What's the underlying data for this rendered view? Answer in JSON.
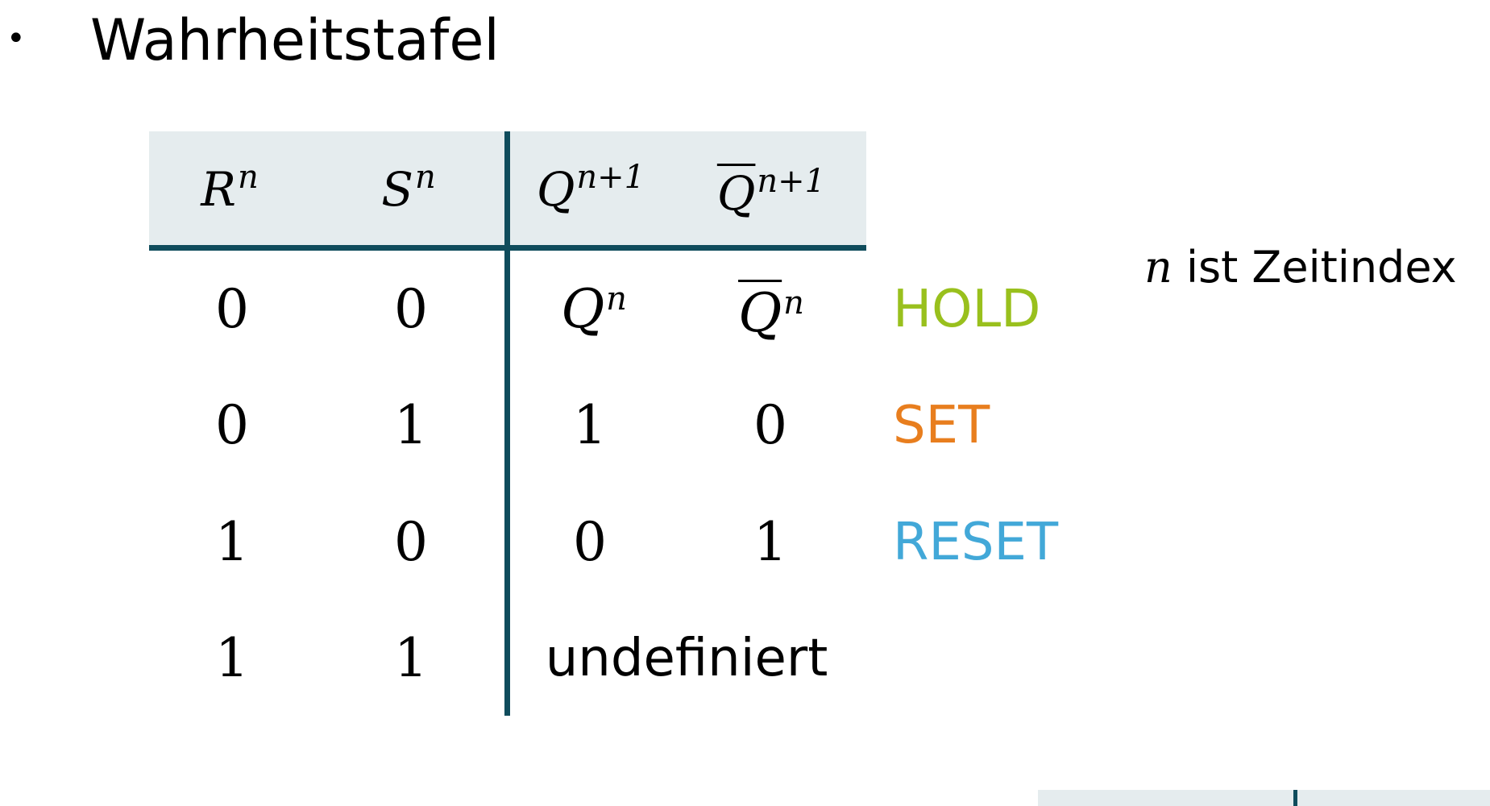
{
  "heading": {
    "bullet": "•",
    "title": "Wahrheitstafel"
  },
  "table": {
    "headers": {
      "r": {
        "base": "R",
        "sup": "n"
      },
      "s": {
        "base": "S",
        "sup": "n"
      },
      "q_next": {
        "base": "Q",
        "sup": "n+1"
      },
      "qbar_next": {
        "base": "Q",
        "sup": "n+1"
      }
    },
    "rows": [
      {
        "r": "0",
        "s": "0",
        "q": {
          "base": "Q",
          "sup": "n"
        },
        "qbar": {
          "base": "Q",
          "sup": "n"
        },
        "status": "HOLD"
      },
      {
        "r": "0",
        "s": "1",
        "q": "1",
        "qbar": "0",
        "status": "SET"
      },
      {
        "r": "1",
        "s": "0",
        "q": "0",
        "qbar": "1",
        "status": "RESET"
      },
      {
        "r": "1",
        "s": "1",
        "undefined_label": "undefiniert"
      }
    ]
  },
  "note": {
    "variable": "n",
    "text": "ist Zeitindex"
  },
  "colors": {
    "hold": "#99c01d",
    "set": "#e87e1e",
    "reset": "#42a8d8",
    "rule": "#0f4c5c",
    "header_bg": "#e5ecee"
  }
}
